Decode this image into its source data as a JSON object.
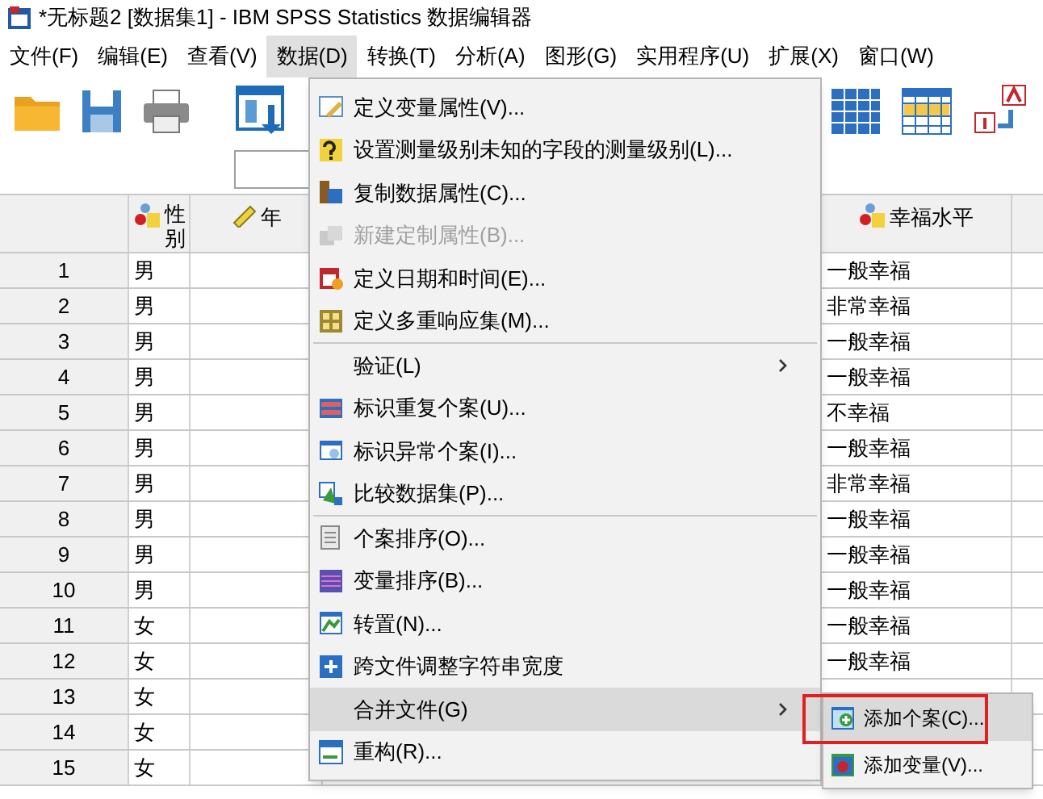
{
  "window": {
    "title": "*无标题2 [数据集1] - IBM SPSS Statistics 数据编辑器"
  },
  "menu_bar": [
    {
      "label": "文件(F)",
      "selected": false
    },
    {
      "label": "编辑(E)",
      "selected": false
    },
    {
      "label": "查看(V)",
      "selected": false
    },
    {
      "label": "数据(D)",
      "selected": true
    },
    {
      "label": "转换(T)",
      "selected": false
    },
    {
      "label": "分析(A)",
      "selected": false
    },
    {
      "label": "图形(G)",
      "selected": false
    },
    {
      "label": "实用程序(U)",
      "selected": false
    },
    {
      "label": "扩展(X)",
      "selected": false
    },
    {
      "label": "窗口(W)",
      "selected": false
    }
  ],
  "grid": {
    "columns": [
      {
        "label": "性别",
        "kind": "nominal"
      },
      {
        "label": "年",
        "kind": "scale"
      },
      {
        "label": "幸福水平",
        "kind": "nominal"
      }
    ],
    "rows": [
      {
        "number": "1",
        "gender": "男",
        "happiness": "一般幸福"
      },
      {
        "number": "2",
        "gender": "男",
        "happiness": "非常幸福"
      },
      {
        "number": "3",
        "gender": "男",
        "happiness": "一般幸福"
      },
      {
        "number": "4",
        "gender": "男",
        "happiness": "一般幸福"
      },
      {
        "number": "5",
        "gender": "男",
        "happiness": "不幸福"
      },
      {
        "number": "6",
        "gender": "男",
        "happiness": "一般幸福"
      },
      {
        "number": "7",
        "gender": "男",
        "happiness": "非常幸福"
      },
      {
        "number": "8",
        "gender": "男",
        "happiness": "一般幸福"
      },
      {
        "number": "9",
        "gender": "男",
        "happiness": "一般幸福"
      },
      {
        "number": "10",
        "gender": "男",
        "happiness": "一般幸福"
      },
      {
        "number": "11",
        "gender": "女",
        "happiness": "一般幸福"
      },
      {
        "number": "12",
        "gender": "女",
        "happiness": "一般幸福"
      },
      {
        "number": "13",
        "gender": "女"
      },
      {
        "number": "14",
        "gender": "女"
      },
      {
        "number": "15",
        "gender": "女"
      }
    ]
  },
  "data_menu": {
    "items": [
      {
        "kind": "item",
        "label": "定义变量属性(V)...",
        "disabled": false,
        "selected": false
      },
      {
        "kind": "item",
        "label": "设置测量级别未知的字段的测量级别(L)...",
        "disabled": false,
        "selected": false
      },
      {
        "kind": "item",
        "label": "复制数据属性(C)...",
        "disabled": false,
        "selected": false
      },
      {
        "kind": "item",
        "label": "新建定制属性(B)...",
        "disabled": true,
        "selected": false
      },
      {
        "kind": "item",
        "label": "定义日期和时间(E)...",
        "disabled": false,
        "selected": false
      },
      {
        "kind": "item",
        "label": "定义多重响应集(M)...",
        "disabled": false,
        "selected": false
      },
      {
        "kind": "separator"
      },
      {
        "kind": "submenu",
        "label": "验证(L)",
        "disabled": false,
        "selected": false
      },
      {
        "kind": "item",
        "label": "标识重复个案(U)...",
        "disabled": false,
        "selected": false
      },
      {
        "kind": "item",
        "label": "标识异常个案(I)...",
        "disabled": false,
        "selected": false
      },
      {
        "kind": "item",
        "label": "比较数据集(P)...",
        "disabled": false,
        "selected": false
      },
      {
        "kind": "separator"
      },
      {
        "kind": "item",
        "label": "个案排序(O)...",
        "disabled": false,
        "selected": false
      },
      {
        "kind": "item",
        "label": "变量排序(B)...",
        "disabled": false,
        "selected": false
      },
      {
        "kind": "item",
        "label": "转置(N)...",
        "disabled": false,
        "selected": false
      },
      {
        "kind": "item",
        "label": "跨文件调整字符串宽度",
        "disabled": false,
        "selected": false
      },
      {
        "kind": "submenu",
        "label": "合并文件(G)",
        "disabled": false,
        "selected": true
      },
      {
        "kind": "item",
        "label": "重构(R)...",
        "disabled": false,
        "selected": false
      }
    ]
  },
  "merge_submenu": {
    "items": [
      {
        "label": "添加个案(C)...",
        "selected": true,
        "annotated": true
      },
      {
        "label": "添加变量(V)...",
        "selected": false,
        "annotated": false
      }
    ]
  }
}
